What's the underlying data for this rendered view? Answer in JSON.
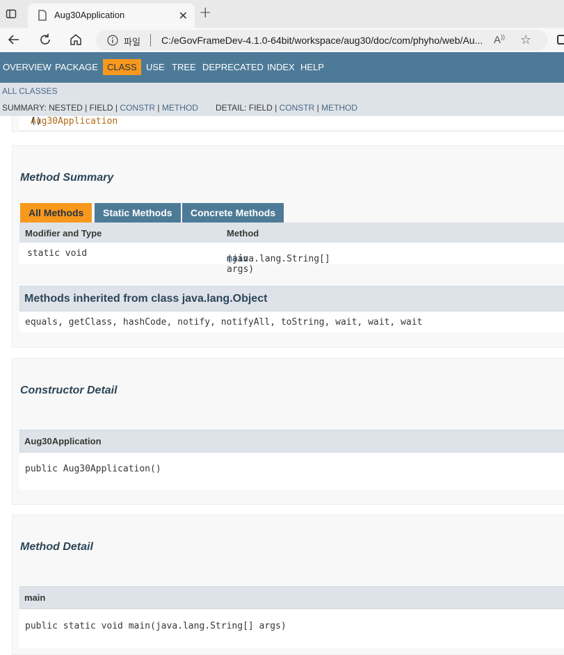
{
  "browser": {
    "tab_title": "Aug30Application",
    "tab_close": "✕",
    "new_tab": "+",
    "file_label": "파일",
    "url": "C:/eGovFrameDev-4.1.0-64bit/workspace/aug30/doc/com/phyho/web/Au...",
    "read_aloud": "A)"
  },
  "topnav": {
    "items": [
      "OVERVIEW",
      "PACKAGE",
      "CLASS",
      "USE",
      "TREE",
      "DEPRECATED",
      "INDEX",
      "HELP"
    ],
    "active": "CLASS"
  },
  "subnav": {
    "all_classes": "ALL CLASSES",
    "summary_prefix": "SUMMARY: NESTED | FIELD | ",
    "summary_constr": "CONSTR",
    "summary_sep": " | ",
    "summary_method": "METHOD",
    "detail_prefix": "DETAIL: FIELD | ",
    "detail_constr": "CONSTR",
    "detail_sep": " | ",
    "detail_method": "METHOD"
  },
  "constructor_summary": {
    "link": "Aug30Application",
    "parens": "()"
  },
  "method_summary": {
    "title": "Method Summary",
    "tabs": [
      "All Methods",
      "Static Methods",
      "Concrete Methods"
    ],
    "active_tab": "All Methods",
    "columns": [
      "Modifier and Type",
      "Method"
    ],
    "rows": [
      {
        "modifier": "static void",
        "method_name": "main",
        "method_params": "(java.lang.String[] args)"
      }
    ]
  },
  "inherited": {
    "title": "Methods inherited from class java.lang.Object",
    "methods": "equals, getClass, hashCode, notify, notifyAll, toString, wait, wait, wait"
  },
  "constructor_detail": {
    "title": "Constructor Detail",
    "name": "Aug30Application",
    "signature": "public Aug30Application()"
  },
  "method_detail": {
    "title": "Method Detail",
    "name": "main",
    "signature": "public static void main(java.lang.String[] args)"
  },
  "colors": {
    "nav_blue": "#4d7a97",
    "accent_orange": "#f8981d",
    "header_gray": "#dee3e9",
    "link_blue": "#4a6782"
  }
}
